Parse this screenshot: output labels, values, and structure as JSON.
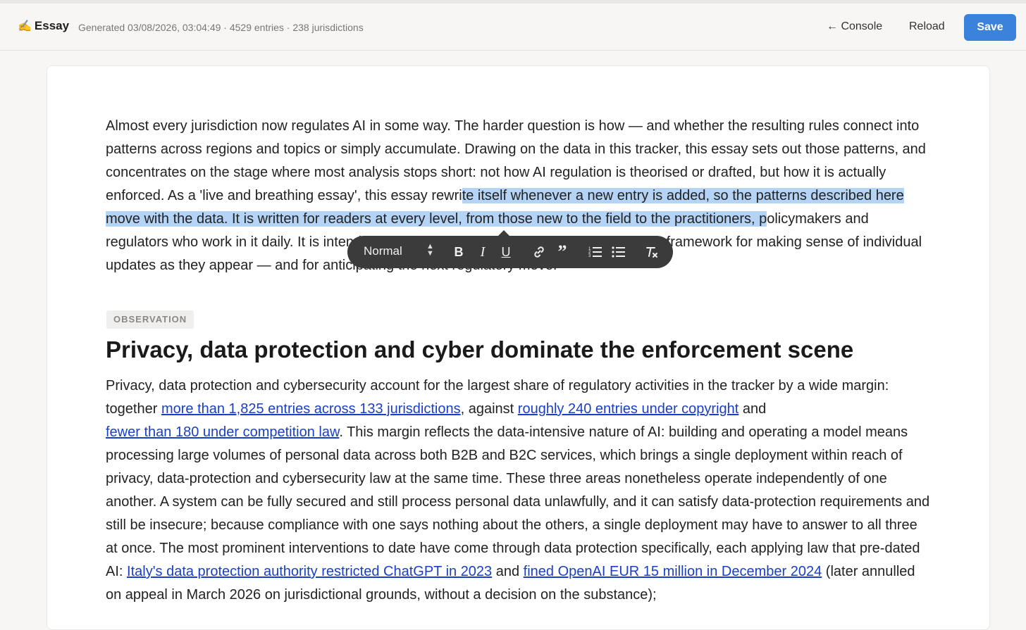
{
  "header": {
    "brand_icon": "✍️",
    "brand_label": "Essay",
    "meta": "Generated 03/08/2026, 03:04:49 · 4529 entries · 238 jurisdictions",
    "console_label": "← Console",
    "reload_label": "Reload",
    "save_label": "Save"
  },
  "essay": {
    "intro_a": "Almost every jurisdiction now regulates AI in some way. The harder question is how — and whether the resulting rules connect into patterns across regions and topics or simply accumulate. Drawing on the data in this tracker, this essay sets out those patterns, and concentrates on the stage where most analysis stops short: not how AI regulation is theorised or drafted, but how it is actually enforced. As a 'live and breathing essay', this essay rewri",
    "intro_selected": "te itself whenever a new entry is added, so the patterns described here move with the data. It is written for readers at every level, from those new to the field to the practitioners, p",
    "intro_b": "olicymakers and regulators who work in it daily. It is intended both as an overview of AI regulation and as a framework for making sense of individual updates as they appear — and for anticipating the next regulatory move.",
    "section_badge": "OBSERVATION",
    "section_title": "Privacy, data protection and cyber dominate the enforcement scene",
    "body_1": "Privacy, data protection and cybersecurity account for the largest share of regulatory activities in the tracker by a wide margin: together ",
    "link_1": "more than 1,825 entries across 133 jurisdictions",
    "body_2": ", against ",
    "link_2": "roughly 240 entries under copyright",
    "body_3": " and ",
    "link_3": "fewer than 180 under competition law",
    "body_4": ". This margin reflects the data-intensive nature of AI: building and operating a model means processing large volumes of personal data across both B2B and B2C services, which brings a single deployment within reach of privacy, data-protection and cybersecurity law at the same time. These three areas nonetheless operate independently of one another. A system can be fully secured and still process personal data unlawfully, and it can satisfy data-protection requirements and still be insecure; because compliance with one says nothing about the others, a single deployment may have to answer to all three at once. The most prominent interventions to date have come through data protection specifically, each applying law that pre-dated AI: ",
    "link_4": "Italy's data protection authority restricted ChatGPT in 2023",
    "body_5": " and ",
    "link_5": "fined OpenAI EUR 15 million in December 2024",
    "body_6": " (later annulled on appeal in March 2026 on jurisdictional grounds, without a decision on the substance);"
  },
  "toolbar": {
    "format_label": "Normal",
    "select_arrows_icon": "up-down-arrows",
    "bold_label": "B",
    "italic_label": "I",
    "underline_label": "U",
    "quote_label": "”",
    "colors": {
      "bg": "#3b3b3b",
      "selection": "#b5d3f5",
      "link": "#1a3fc4",
      "accent": "#3b82dc"
    }
  }
}
